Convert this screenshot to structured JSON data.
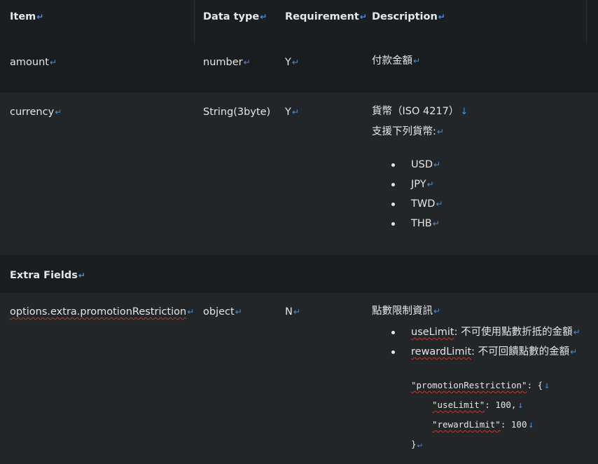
{
  "headers": {
    "item": "Item",
    "data_type": "Data type",
    "requirement": "Requirement",
    "description": "Description"
  },
  "rows": {
    "amount": {
      "item": "amount",
      "data_type": "number",
      "requirement": "Y",
      "description": "付款金額"
    },
    "currency": {
      "item": "currency",
      "data_type": "String(3byte)",
      "requirement": "Y",
      "description_line1": "貨幣（ISO 4217）",
      "description_line2": "支援下列貨幣:",
      "currencies": [
        "USD",
        "JPY",
        "TWD",
        "THB"
      ]
    },
    "extra_fields": {
      "label": "Extra Fields"
    },
    "promotion": {
      "item": "options.extra.promotionRestriction",
      "data_type": "object",
      "requirement": "N",
      "description": "點數限制資訊",
      "bullets": [
        {
          "key": "useLimit",
          "sep": ": ",
          "text": "不可使用點數折抵的金額"
        },
        {
          "key": "rewardLimit",
          "sep": ": ",
          "text": "不可回饋點數的金額"
        }
      ],
      "code": {
        "line1_key": "\"promotionRestriction\"",
        "line1_rest": ": {",
        "line2_key": "\"useLimit\"",
        "line2_rest": ": 100,",
        "line3_key": "\"rewardLimit\"",
        "line3_rest": ": 100",
        "line4": "}"
      }
    }
  },
  "marks": {
    "paragraph": "↵",
    "line_break": "↓"
  },
  "colors": {
    "background": "#212529",
    "header_bg": "#1b1e21",
    "mark": "#4a8fd6",
    "spell_underline": "#c0392b"
  }
}
